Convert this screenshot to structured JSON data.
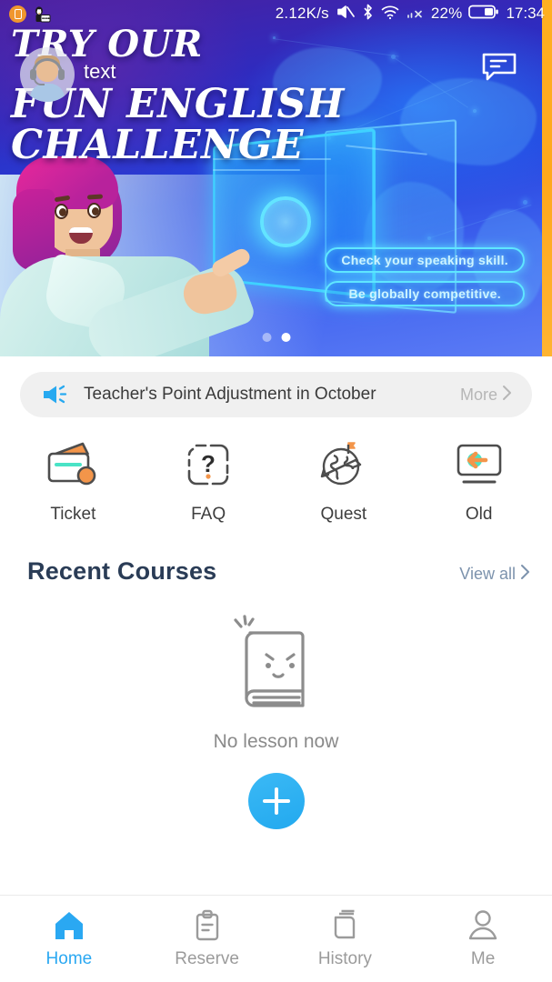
{
  "statusbar": {
    "network_speed": "2.12K/s",
    "battery_percent": "22%",
    "time": "17:34",
    "icons": [
      "app-orange-icon",
      "penguin-icon",
      "volume-mute-icon",
      "bluetooth-icon",
      "wifi-icon",
      "signal-off-icon",
      "battery-icon"
    ]
  },
  "banner": {
    "headline_line1": "TRY OUR",
    "headline_line2": "FUN ENGLISH CHALLENGE",
    "avatar_label": "text",
    "pills": [
      "Check your speaking skill.",
      "Be globally competitive."
    ],
    "chat_icon": "chat-bubble-icon",
    "dots_total": 2,
    "dots_active_index": 1
  },
  "notice": {
    "icon": "megaphone-icon",
    "text": "Teacher's Point Adjustment in October",
    "more_label": "More",
    "chevron": "›"
  },
  "quick_actions": [
    {
      "label": "Ticket",
      "icon": "wallet-icon"
    },
    {
      "label": "FAQ",
      "icon": "question-mark-icon"
    },
    {
      "label": "Quest",
      "icon": "globe-flag-icon"
    },
    {
      "label": "Old",
      "icon": "monitor-back-arrow-icon"
    }
  ],
  "recent_courses": {
    "title": "Recent Courses",
    "view_all_label": "View all",
    "chevron": "›",
    "empty_icon": "book-face-icon",
    "empty_text": "No lesson now",
    "add_button_label": "+"
  },
  "tabbar": [
    {
      "label": "Home",
      "icon": "home-icon",
      "active": true
    },
    {
      "label": "Reserve",
      "icon": "clipboard-icon",
      "active": false
    },
    {
      "label": "History",
      "icon": "books-icon",
      "active": false
    },
    {
      "label": "Me",
      "icon": "person-icon",
      "active": false
    }
  ],
  "colors": {
    "accent_blue": "#2aa8f2",
    "title_navy": "#2a3c56",
    "neon_cyan": "#5fe6ff",
    "orange": "#f0962e",
    "strip_amber": "#ffb020"
  }
}
